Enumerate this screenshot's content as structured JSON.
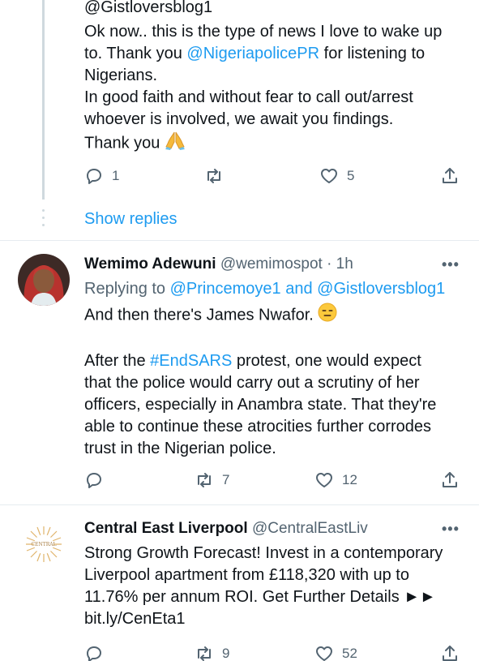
{
  "tweet1": {
    "partial_handle": "@Gistloversblog1",
    "line1": "Ok now.. this is the type of news I love to wake up",
    "line2_pre": "to. Thank you ",
    "line2_mention": "@NigeriapolicePR",
    "line2_post": " for listening to",
    "line3": "Nigerians.",
    "line4": "In good faith and without fear to call out/arrest",
    "line5": "whoever is involved, we await you findings.",
    "line6": "Thank you",
    "replies": "1",
    "retweets": "",
    "likes": "5",
    "show_replies": "Show replies"
  },
  "tweet2": {
    "name": "Wemimo Adewuni",
    "handle": "@wemimospot",
    "time": "· 1h",
    "replying_prefix": "Replying to ",
    "replying_to_1": "@Princemoye1",
    "replying_and": " and ",
    "replying_to_2": "@Gistloversblog1",
    "line1": "And then there's James Nwafor.",
    "p2_line1_pre": "After the ",
    "p2_hashtag": "#EndSARS",
    "p2_line1_post": " protest, one would expect",
    "p2_line2": "that the police would carry out a scrutiny of her",
    "p2_line3": "officers, especially in Anambra state. That they're",
    "p2_line4": "able to continue these atrocities further corrodes",
    "p2_line5": "trust in the Nigerian police.",
    "replies": "",
    "retweets": "7",
    "likes": "12"
  },
  "tweet3": {
    "name": "Central East Liverpool",
    "handle": "@CentralEastLiv",
    "avatar_text": "CENTRAL",
    "line1": "Strong Growth Forecast! Invest in a contemporary",
    "line2": "Liverpool apartment from £118,320 with up to",
    "line3": "11.76% per annum ROI. Get Further Details ►►",
    "link": "bit.ly/CenEta1",
    "replies": "",
    "retweets": "9",
    "likes": "52"
  },
  "more_menu": "•••",
  "colors": {
    "link": "#1d9bf0",
    "muted": "#536471",
    "text": "#0f1419",
    "divider": "#e6ecf0"
  }
}
